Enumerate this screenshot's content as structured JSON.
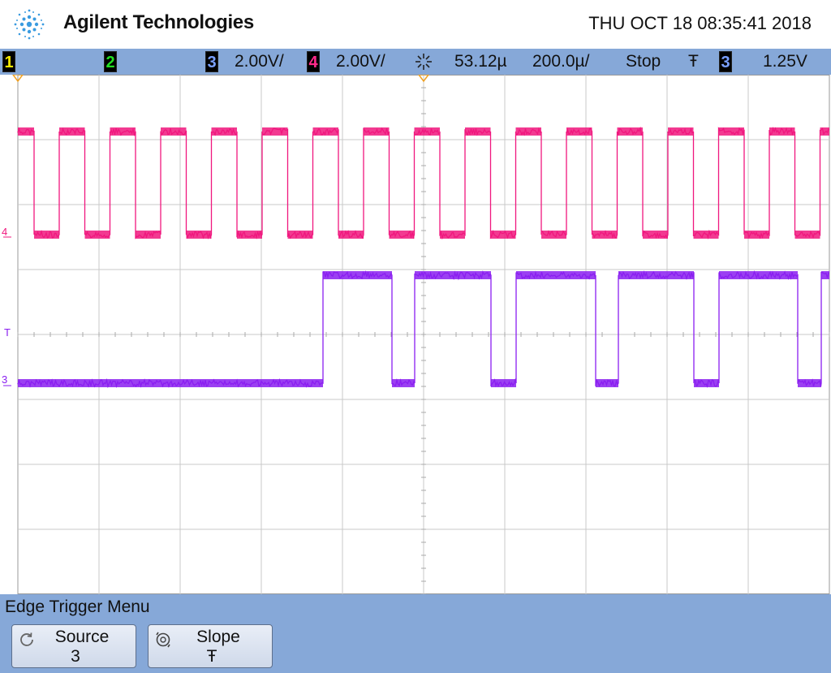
{
  "header": {
    "brand": "Agilent Technologies",
    "datetime": "THU OCT 18 08:35:41 2018"
  },
  "status": {
    "ch1_label": "1",
    "ch2_label": "2",
    "ch3_label": "3",
    "ch3_scale": "2.00V/",
    "ch4_label": "4",
    "ch4_scale": "2.00V/",
    "delay": "53.12µ",
    "timebase": "200.0µ/",
    "run_state": "Stop",
    "slope_symbol": "Ŧ",
    "trigger_source": "3",
    "trigger_level": "1.25V"
  },
  "markers": {
    "ch4_marker": "4",
    "trigger_marker": "T",
    "ch3_marker": "3"
  },
  "colors": {
    "ch3": "#8a1ef0",
    "ch4": "#f0177e",
    "grid": "#c8c8c8",
    "menu": "#86a8d8"
  },
  "menu": {
    "title": "Edge Trigger Menu",
    "softkeys": [
      {
        "label": "Source",
        "value": "3",
        "icon": "rotate-knob-icon"
      },
      {
        "label": "Slope",
        "value": "Ŧ",
        "icon": "rotate-knob-icon"
      }
    ]
  },
  "waveforms": {
    "ch4_pattern": "square clock, ~16 periods across screen",
    "ch3_pattern": "low then data bursts"
  }
}
